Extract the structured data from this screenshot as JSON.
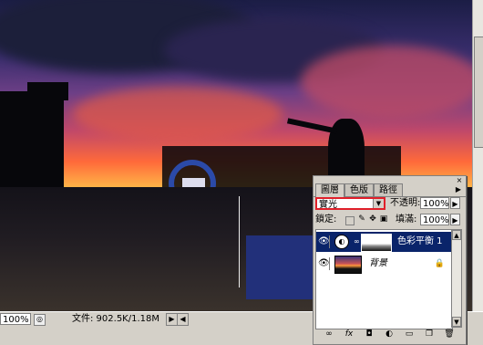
{
  "canvas": {
    "description_icons": [
      "photo-canvas"
    ]
  },
  "statusbar": {
    "zoom": "100%",
    "doc_info": "文件: 902.5K/1.18M",
    "nav_left": "◀",
    "nav_right": "▶"
  },
  "panel": {
    "tabs": [
      "圖層",
      "色版",
      "路徑"
    ],
    "blend_mode": "實光",
    "opacity_label": "不透明:",
    "opacity_value": "100%",
    "lock_label": "鎖定:",
    "fill_label": "填滿:",
    "fill_value": "100%",
    "layers": [
      {
        "name": "色彩平衡 1",
        "selected": true,
        "type": "adjustment"
      },
      {
        "name": "背景",
        "selected": false,
        "type": "background"
      }
    ]
  },
  "colors": {
    "highlight_red": "#e0202a",
    "selected_layer": "#0a246a",
    "chrome": "#d4d0c8"
  },
  "icons": [
    "eye-icon",
    "adjustment-icon",
    "chain-icon",
    "lock-icon",
    "link-icon",
    "fx-icon",
    "mask-icon",
    "new-adjustment-icon",
    "folder-icon",
    "new-layer-icon",
    "trash-icon"
  ]
}
